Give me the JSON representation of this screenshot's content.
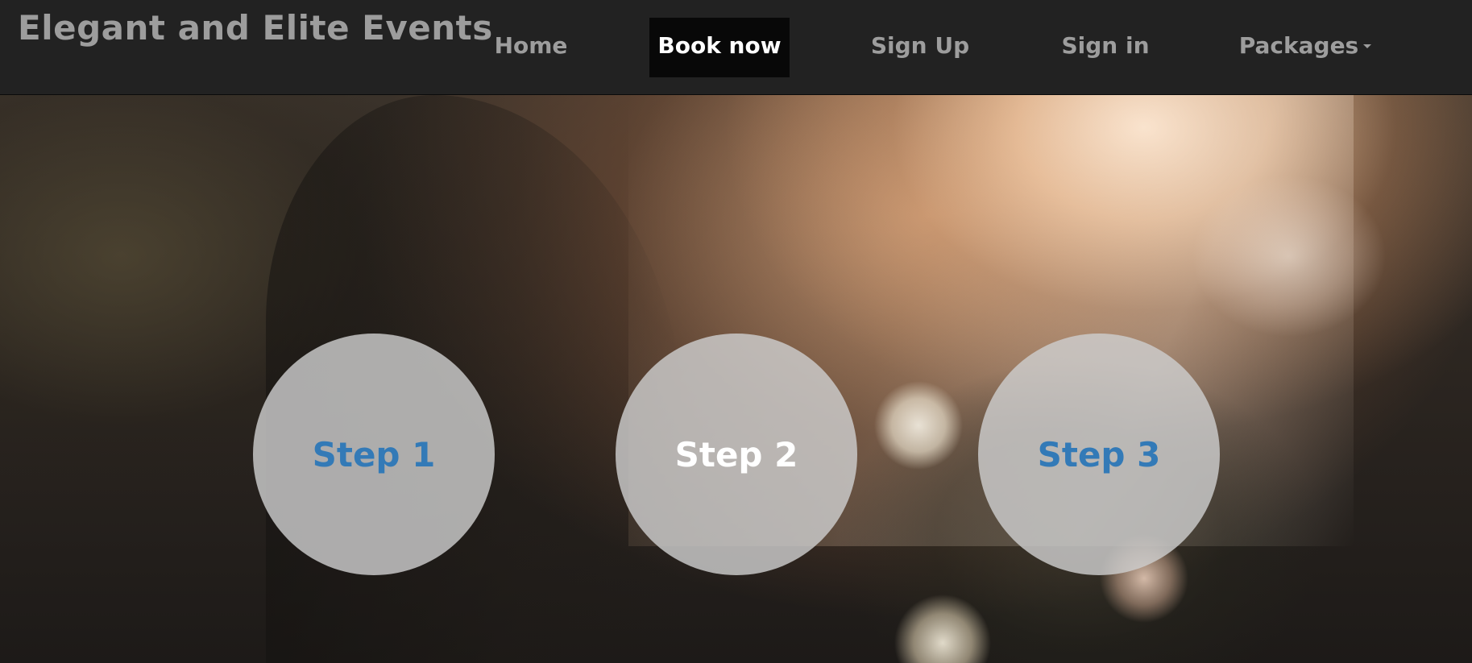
{
  "navbar": {
    "brand": "Elegant and Elite Events",
    "items": [
      {
        "label": "Home",
        "active": false
      },
      {
        "label": "Book now",
        "active": true
      },
      {
        "label": "Sign Up",
        "active": false
      },
      {
        "label": "Sign in",
        "active": false
      },
      {
        "label": "Packages",
        "active": false,
        "has_dropdown": true
      }
    ]
  },
  "steps": [
    {
      "label": "Step 1"
    },
    {
      "label": "Step 2",
      "highlighted": true
    },
    {
      "label": "Step 3"
    }
  ],
  "colors": {
    "navbar_bg": "#222222",
    "nav_text": "#9d9d9d",
    "active_bg": "#080808",
    "active_text": "#ffffff",
    "step_text": "#337ab7",
    "step_active_text": "#ffffff",
    "step_circle_bg": "#cdcdcd"
  },
  "icons": {
    "packages_dropdown": "caret-down-icon"
  }
}
